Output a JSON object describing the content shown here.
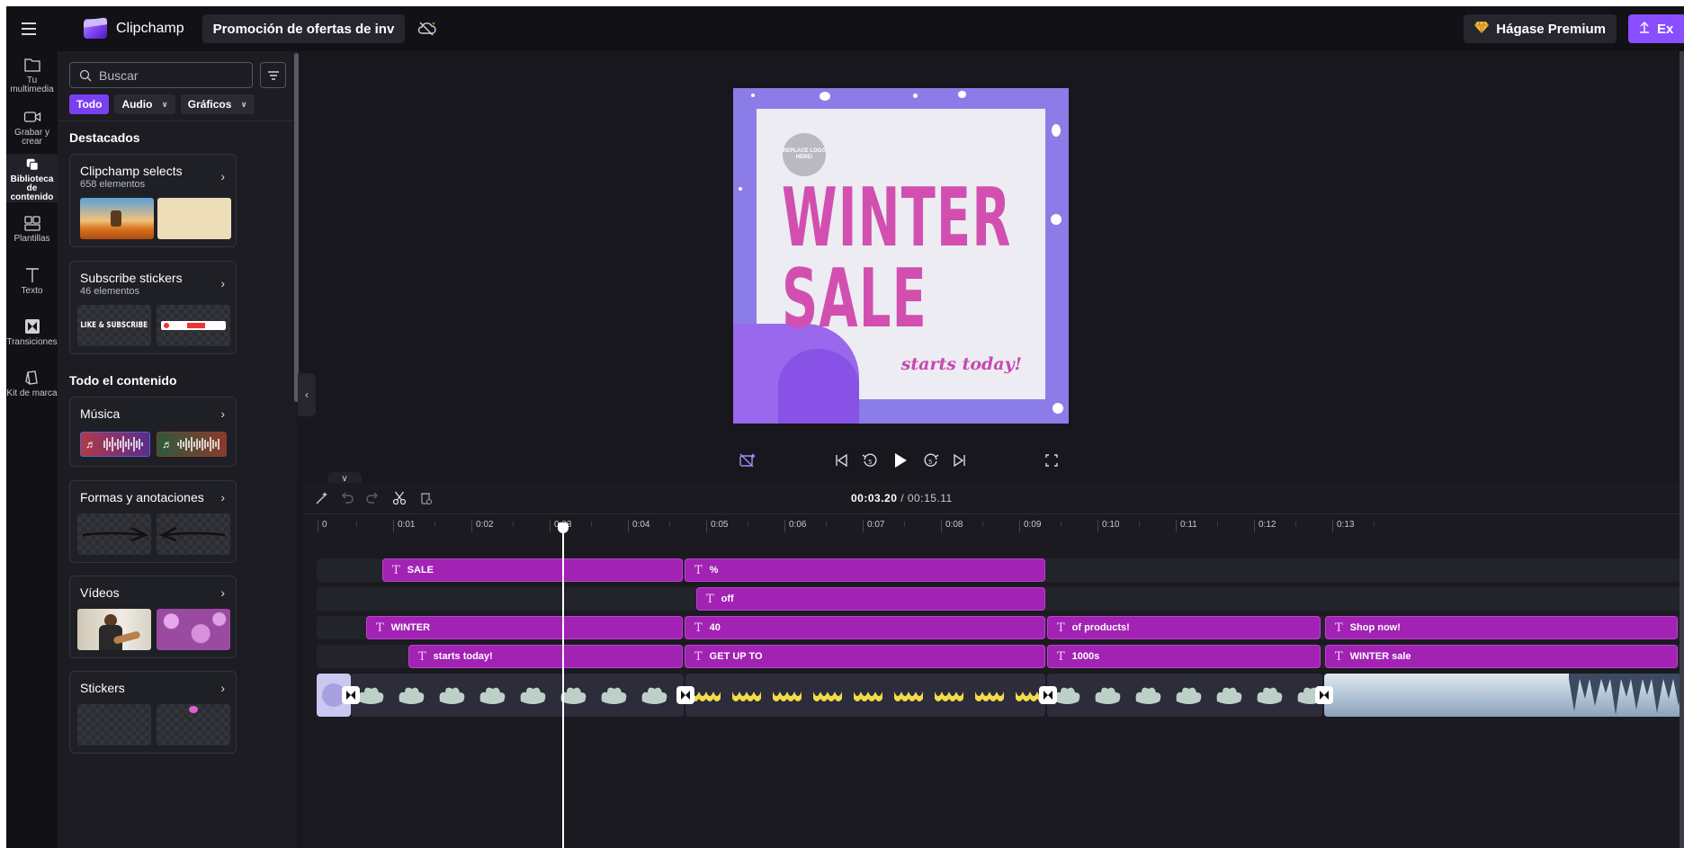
{
  "topbar": {
    "app_name": "Clipchamp",
    "project_title": "Promoción de ofertas de inv",
    "premium_label": "Hágase Premium",
    "export_label": "Ex"
  },
  "rail": {
    "items": [
      {
        "label": "Tu multimedia",
        "icon": "folder-icon"
      },
      {
        "label": "Grabar y crear",
        "icon": "camera-icon"
      },
      {
        "label": "Biblioteca de contenido",
        "icon": "library-icon",
        "active": true
      },
      {
        "label": "Plantillas",
        "icon": "templates-icon"
      },
      {
        "label": "Texto",
        "icon": "text-icon"
      },
      {
        "label": "Transiciones",
        "icon": "transitions-icon"
      },
      {
        "label": "Kit de marca",
        "icon": "brand-kit-icon"
      }
    ]
  },
  "panel": {
    "search_placeholder": "Buscar",
    "chips": [
      {
        "label": "Todo",
        "active": true
      },
      {
        "label": "Audio"
      },
      {
        "label": "Gráficos"
      }
    ],
    "featured_title": "Destacados",
    "cards": [
      {
        "title": "Clipchamp selects",
        "subtitle": "658 elementos"
      },
      {
        "title": "Subscribe stickers",
        "subtitle": "46 elementos"
      }
    ],
    "all_title": "Todo el contenido",
    "categories": [
      {
        "title": "Música"
      },
      {
        "title": "Formas y anotaciones"
      },
      {
        "title": "Vídeos"
      },
      {
        "title": "Stickers"
      }
    ],
    "sticker_text": "LIKE & SUBSCRIBE"
  },
  "preview": {
    "logo_placeholder": "REPLACE LOGO HERE!",
    "line1": "WINTER",
    "line2": "SALE",
    "tagline": "starts today!",
    "bg_color": "#8c7ce8",
    "text_color": "#d24fb0"
  },
  "timeline": {
    "current_time": "00:03.20",
    "total_time": "/ 00:15.11",
    "ticks": [
      "0",
      "0:01",
      "0:02",
      "0:03",
      "0:04",
      "0:05",
      "0:06",
      "0:07",
      "0:08",
      "0:09",
      "0:10",
      "0:11",
      "0:12",
      "0:13"
    ],
    "tracks": [
      [
        {
          "label": "SALE"
        },
        {
          "label": "%"
        }
      ],
      [
        {
          "label": "off"
        }
      ],
      [
        {
          "label": "WINTER"
        },
        {
          "label": "40"
        },
        {
          "label": "of products!"
        },
        {
          "label": "Shop now!"
        }
      ],
      [
        {
          "label": "starts today!"
        },
        {
          "label": "GET UP TO"
        },
        {
          "label": "1000s"
        },
        {
          "label": "WINTER sale"
        }
      ]
    ],
    "clip_color": "#a222b4"
  }
}
